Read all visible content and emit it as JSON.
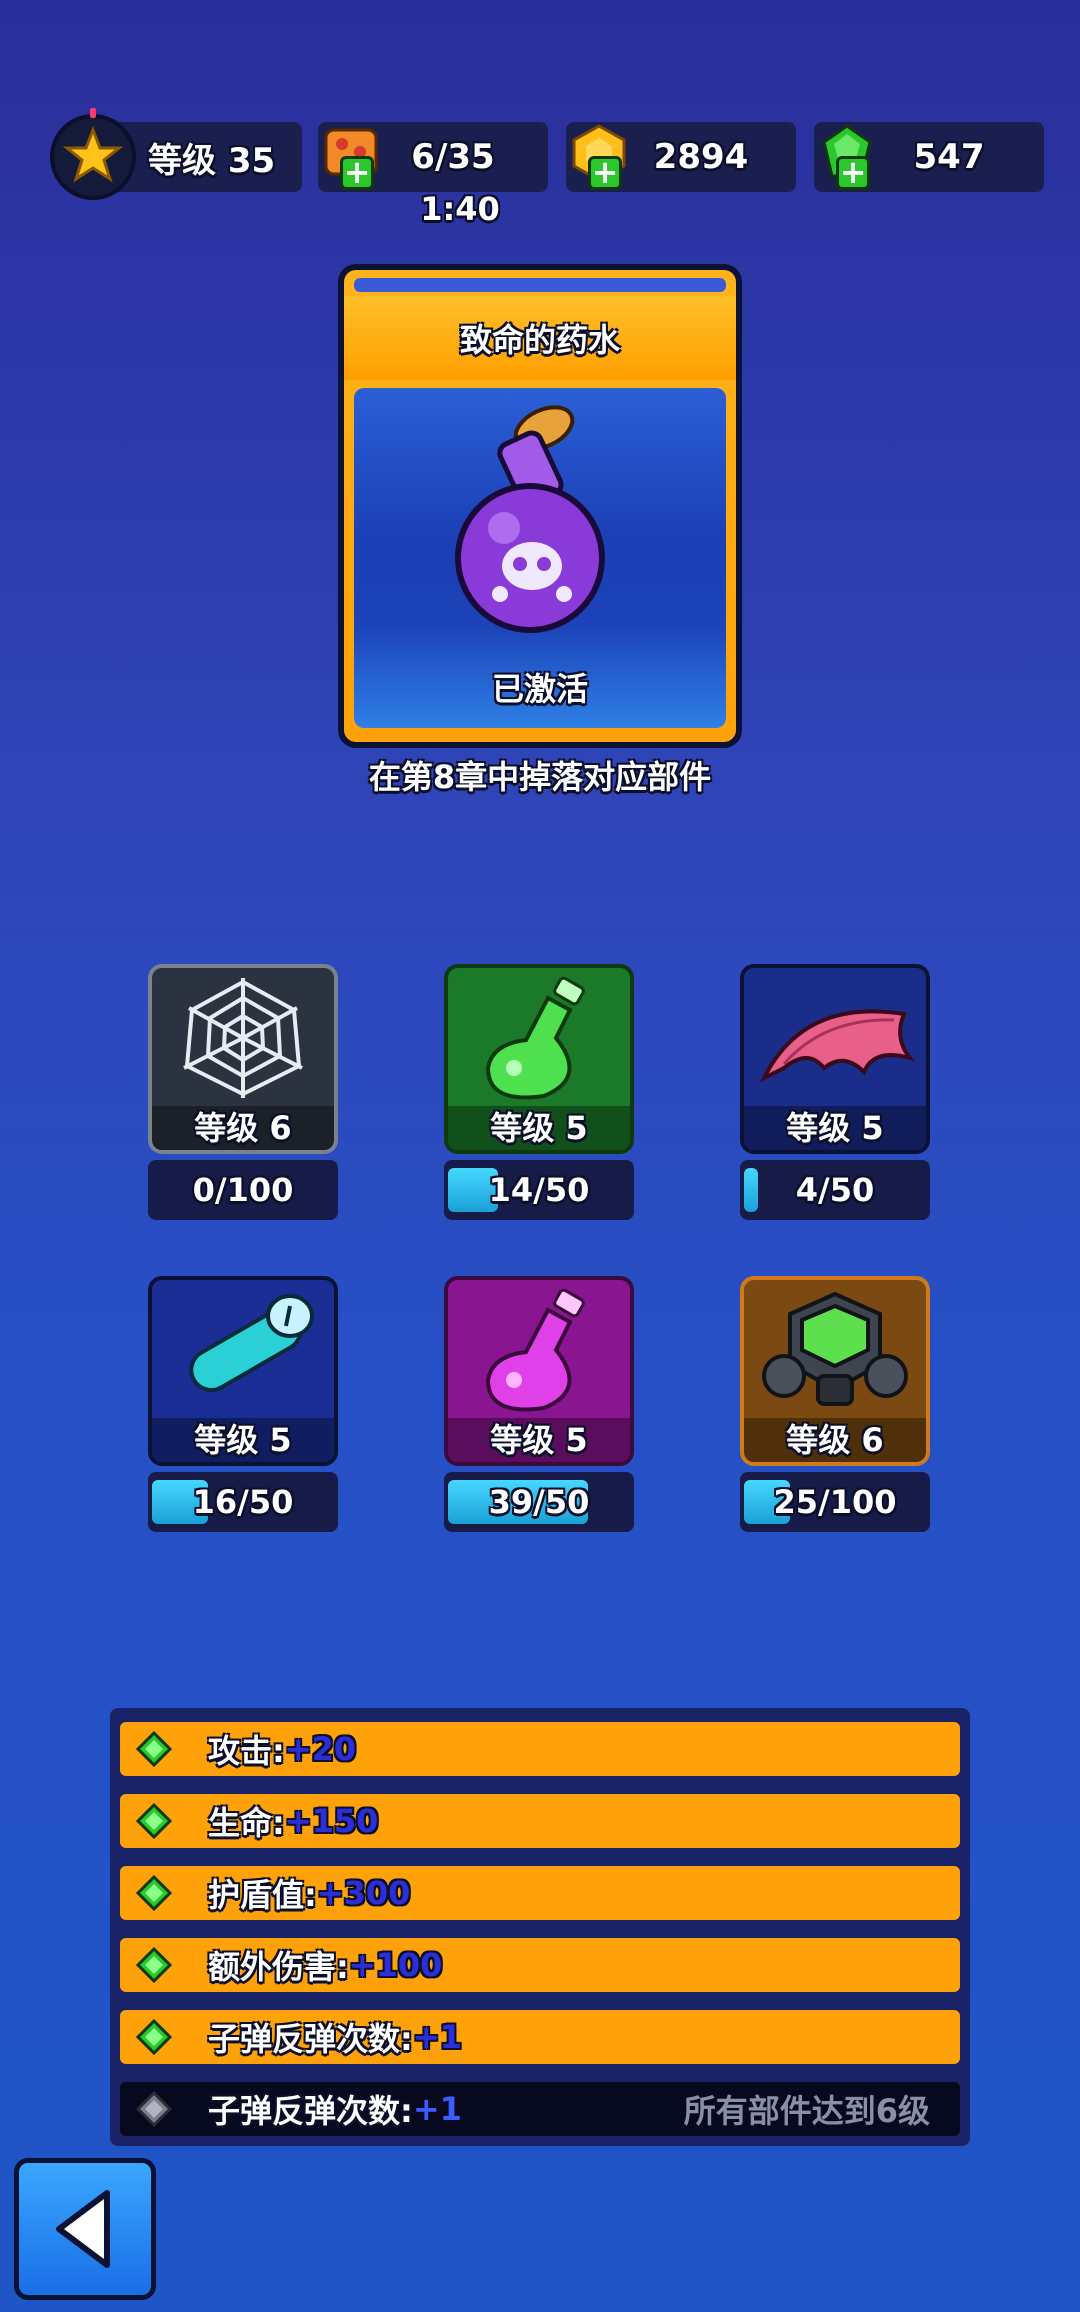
{
  "top_bar": {
    "level_label": "等级 35",
    "energy_value": "6/35",
    "energy_timer": "1:40",
    "coins_value": "2894",
    "gems_value": "547"
  },
  "hero_item": {
    "title": "致命的药水",
    "status": "已激活",
    "caption": "在第8章中掉落对应部件"
  },
  "parts": [
    {
      "icon": "spider-web-icon",
      "level": "等级 6",
      "progress_text": "0/100",
      "progress": 0.0,
      "bg": "#2b3340"
    },
    {
      "icon": "green-flask-icon",
      "level": "等级 5",
      "progress_text": "14/50",
      "progress": 0.28,
      "bg": "#1b7a2a"
    },
    {
      "icon": "bat-wing-icon",
      "level": "等级 5",
      "progress_text": "4/50",
      "progress": 0.08,
      "bg": "#1b2d8a"
    },
    {
      "icon": "vial-icon",
      "level": "等级 5",
      "progress_text": "16/50",
      "progress": 0.32,
      "bg": "#1a2e96"
    },
    {
      "icon": "purple-flask-icon",
      "level": "等级 5",
      "progress_text": "39/50",
      "progress": 0.78,
      "bg": "#8a1590"
    },
    {
      "icon": "gas-mask-icon",
      "level": "等级 6",
      "progress_text": "25/100",
      "progress": 0.25,
      "bg": "#7a4a12"
    }
  ],
  "bonuses": [
    {
      "label": "攻击:",
      "value": "+20",
      "active": true
    },
    {
      "label": "生命:",
      "value": "+150",
      "active": true
    },
    {
      "label": "护盾值:",
      "value": "+300",
      "active": true
    },
    {
      "label": "额外伤害:",
      "value": "+100",
      "active": true
    },
    {
      "label": "子弹反弹次数:",
      "value": "+1",
      "active": true
    },
    {
      "label": "子弹反弹次数:",
      "value": "+1",
      "active": false,
      "requirement": "所有部件达到6级"
    }
  ],
  "colors": {
    "accent_orange": "#ffa20a",
    "gem_green": "#2cc72c",
    "panel_dark": "#1a1f4f"
  }
}
